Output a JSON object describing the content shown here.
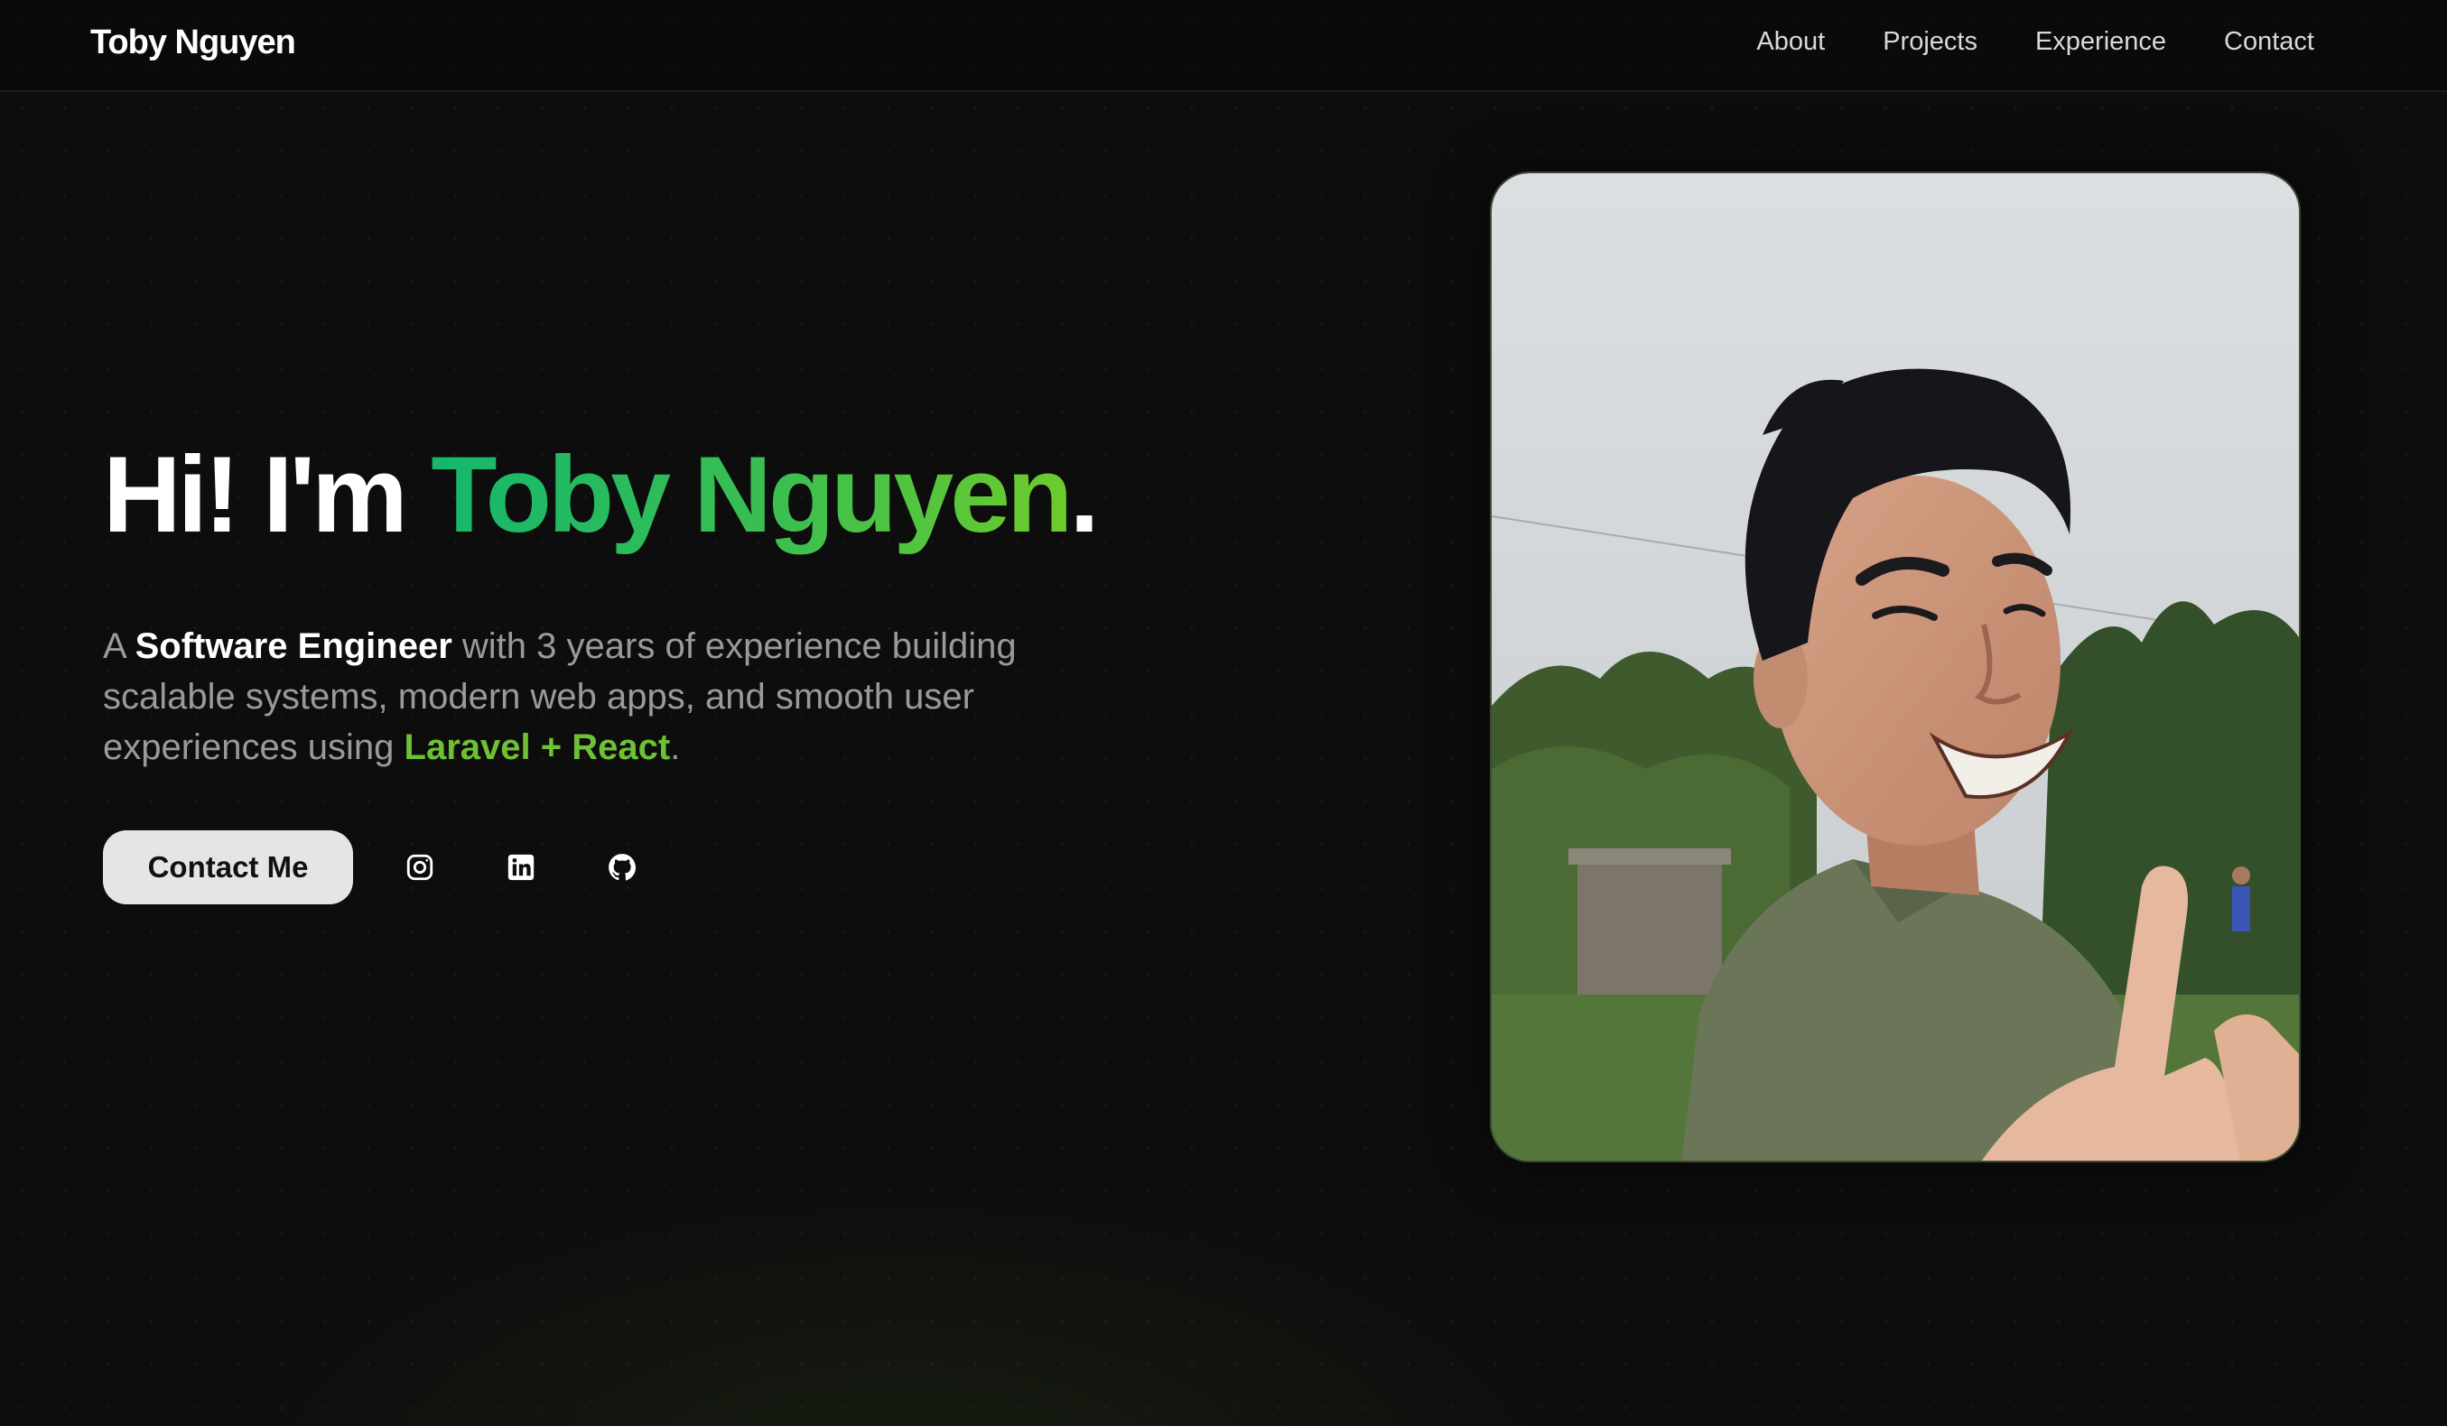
{
  "nav": {
    "brand": "Toby Nguyen",
    "links": [
      {
        "label": "About"
      },
      {
        "label": "Projects"
      },
      {
        "label": "Experience"
      },
      {
        "label": "Contact"
      }
    ]
  },
  "hero": {
    "greeting": "Hi! I'm ",
    "name": "Toby Nguyen",
    "period": ".",
    "sub_pre": "A ",
    "sub_role": "Software Engineer",
    "sub_mid": " with 3 years of experience building scalable systems, modern web apps, and smooth user experiences using ",
    "sub_stack": "Laravel + React",
    "sub_end": ".",
    "contact_button": "Contact Me",
    "socials": [
      {
        "icon": "instagram-icon"
      },
      {
        "icon": "linkedin-icon"
      },
      {
        "icon": "github-icon"
      }
    ]
  },
  "colors": {
    "background": "#0d0d0d",
    "accent_start": "#15b76e",
    "accent_end": "#6ecb2c",
    "stack_accent": "#6ec135",
    "button_bg": "#e5e5e5"
  }
}
